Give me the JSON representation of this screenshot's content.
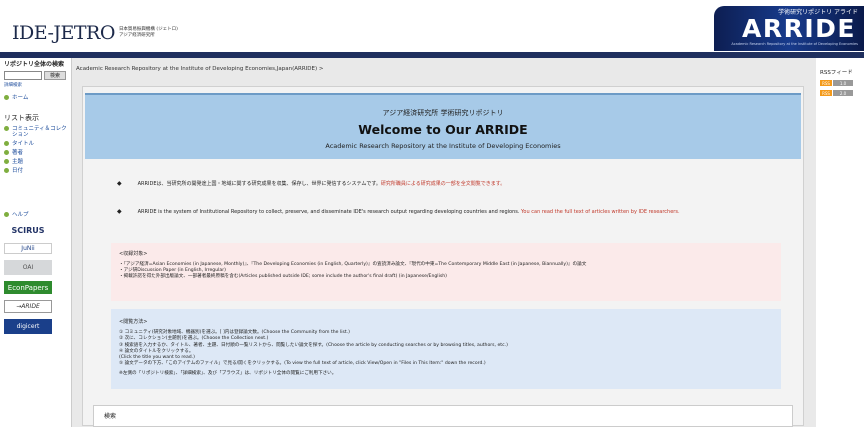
{
  "header": {
    "logo_main": "IDE-JETRO",
    "logo_sub_line1": "日本貿易振興機構 (ジェトロ)",
    "logo_sub_line2": "アジア経済研究所",
    "banner_top": "学術研究リポジトリ アライド",
    "banner_main": "ARRIDE",
    "banner_sub": "Academic Research Repository at the Institute of Developing Economies"
  },
  "sidebar": {
    "search_title": "リポジトリ全体の検索",
    "search_input_value": "",
    "search_button": "検索",
    "advanced_search": "詳細検索",
    "home": "ホーム",
    "list_title": "リスト表示",
    "list_items": [
      "コミュニティ＆コレクション",
      "タイトル",
      "著者",
      "主題",
      "日付"
    ],
    "help": "ヘルプ",
    "badges": [
      "SCIRUS",
      "JuNii",
      "OAI",
      "EconPapers",
      "→ARIDE",
      "digicert"
    ]
  },
  "breadcrumb": "Academic Research Repository at the Institute of Developing Economies,Japan(ARRIDE) >",
  "welcome": {
    "jp": "アジア経済研究所 学術研究リポジトリ",
    "title": "Welcome to Our ARRIDE",
    "subtitle": "Academic Research Repository at the Institute of Developing Economies"
  },
  "descriptions": [
    {
      "bullet": "◆",
      "text": "ARRIDEは、当研究所の開発途上国・地域に関する研究成果を収集、保存し、世界に発信するシステムです。",
      "red": "研究所職員による研究成果の一部を全文閲覧できます。"
    },
    {
      "bullet": "◆",
      "text": "ARRIDE is the system of Institutional Repository to collect, preserve, and disseminate IDE's research output regarding developing countries and regions.",
      "red": "You can read the full text of articles written by IDE researchers."
    }
  ],
  "targets": {
    "title": "<収録対象>",
    "items": [
      "・『アジア経済=Asian Economies (in Japanese, Monthly)』、『The Developing Economies (in English, Quarterly)』の査読済み論文、『現代の中東=The Contemporary Middle East (in Japanese, Biannually)』の論文",
      "・アジ研Discussion Paper (in English, Irregular)",
      "・掲載許諾を得た外部出版論文、一部著者最終原稿を含む(Articles published outside IDE; some include the author's final draft) (in Japanese/English)"
    ]
  },
  "howto": {
    "title": "<閲覧方法>",
    "items": [
      "① コミュニティ(研究対象地域、機器別)を選ぶ。[ ]内は登録論文数。(Choose the Community from the list.)",
      "② 次に、コレクション(主題別)を選ぶ。(Choose the Collection next.)",
      "③ 検索語を入力するか、タイトル、著者、主題、日付順の一覧リストから、閲覧したい論文を探す。(Choose the article by conducting searches or by browsing titles, authors, etc.)",
      "④ 論文のタイトルをクリックする。",
      "(Click the title you want to read.)",
      "⑤ 論文データの下方、「このアイテムのファイル」で見る/開くをクリックする。(To view the full text of article, click View/Open in \"Files in This Item:\" down the record.)"
    ],
    "note": "※左側の「リポジトリ検索」、「詳細検索」、及び「ブラウズ」は、リポジトリ全体の閲覧にご利用下さい。"
  },
  "next_panel": "検索",
  "rss": {
    "title": "RSSフィード",
    "badges": [
      {
        "label": "RSS",
        "version": "1.0"
      },
      {
        "label": "RSS",
        "version": "2.0"
      }
    ]
  },
  "colors": {
    "nav_bar": "#1f2f5e",
    "welcome_bg": "#a7cae8",
    "target_box_bg": "#fbeaea",
    "howto_box_bg": "#dde8f6",
    "link": "#1a4a9a",
    "highlight_text": "#c0392b"
  }
}
